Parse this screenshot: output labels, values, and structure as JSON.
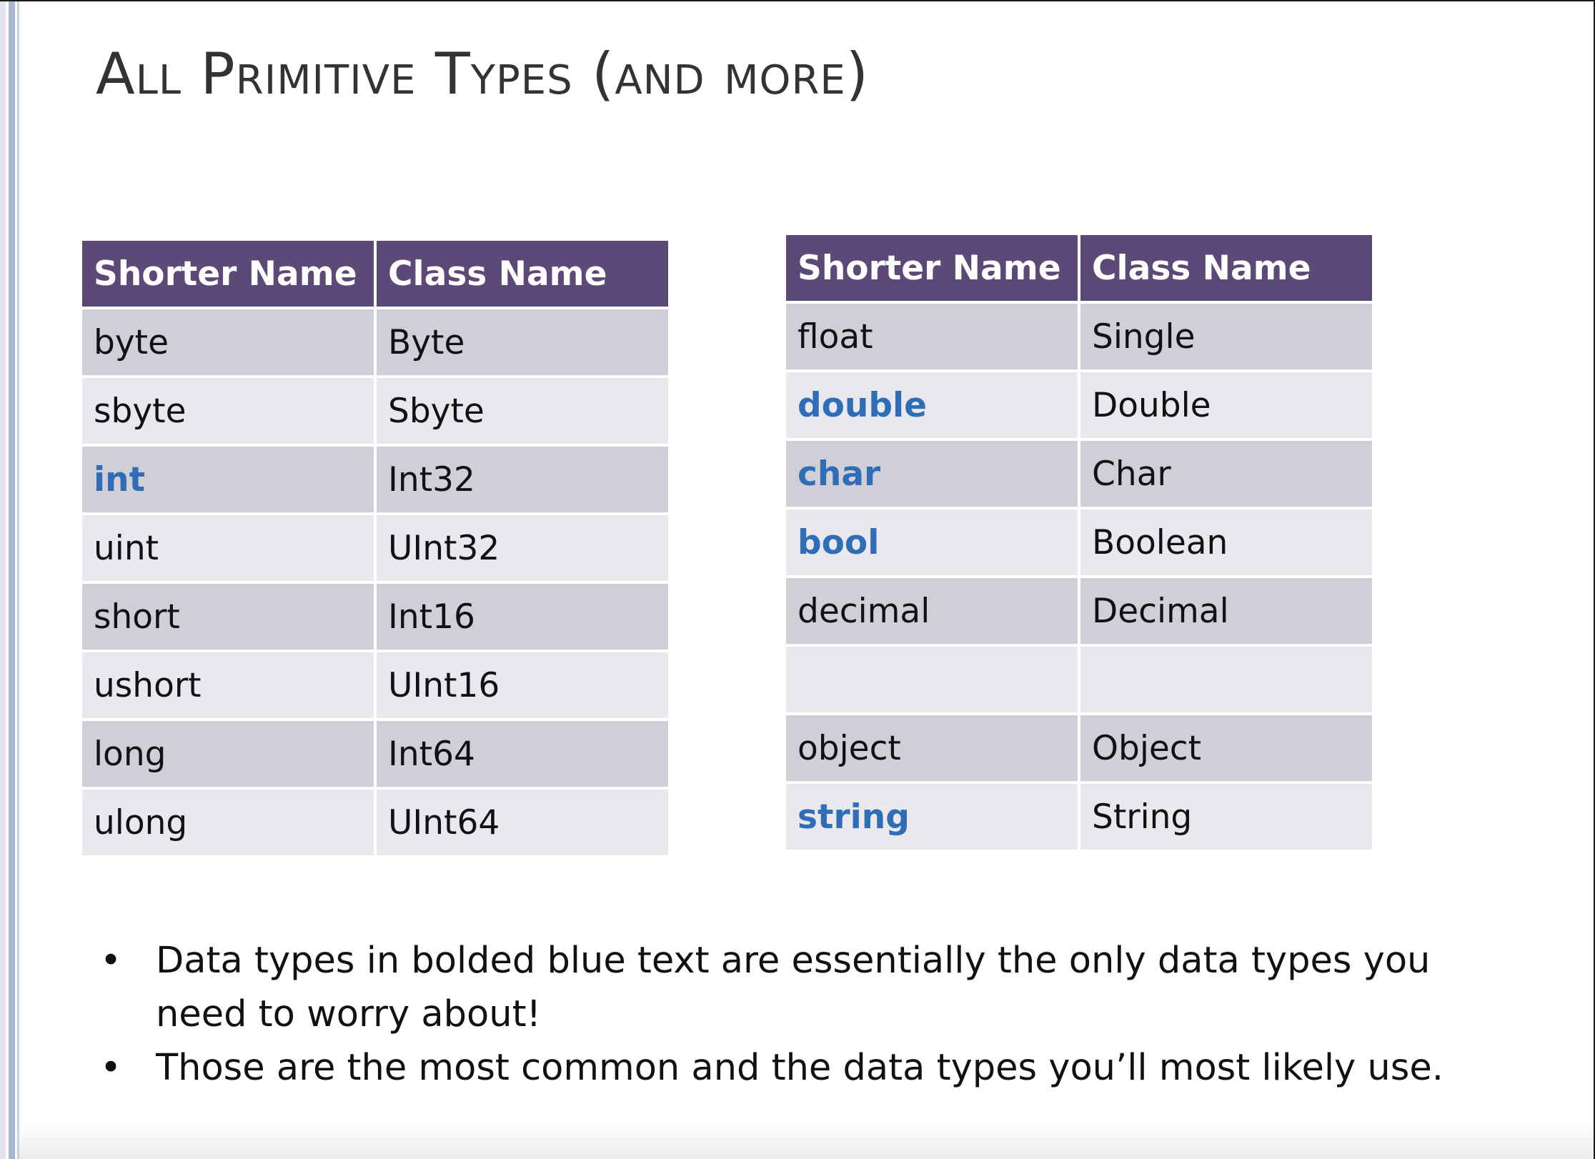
{
  "slide": {
    "title": "All Primitive Types (and more)"
  },
  "table_left": {
    "headers": [
      "Shorter Name",
      "Class Name"
    ],
    "rows": [
      {
        "short": "byte",
        "class": "Byte",
        "highlight": false
      },
      {
        "short": "sbyte",
        "class": "Sbyte",
        "highlight": false
      },
      {
        "short": "int",
        "class": "Int32",
        "highlight": true
      },
      {
        "short": "uint",
        "class": "UInt32",
        "highlight": false
      },
      {
        "short": "short",
        "class": "Int16",
        "highlight": false
      },
      {
        "short": "ushort",
        "class": "UInt16",
        "highlight": false
      },
      {
        "short": "long",
        "class": "Int64",
        "highlight": false
      },
      {
        "short": "ulong",
        "class": "UInt64",
        "highlight": false
      }
    ]
  },
  "table_right": {
    "headers": [
      "Shorter Name",
      "Class Name"
    ],
    "rows": [
      {
        "short": "float",
        "class": "Single",
        "highlight": false
      },
      {
        "short": "double",
        "class": "Double",
        "highlight": true
      },
      {
        "short": "char",
        "class": "Char",
        "highlight": true
      },
      {
        "short": "bool",
        "class": "Boolean",
        "highlight": true
      },
      {
        "short": "decimal",
        "class": "Decimal",
        "highlight": false
      },
      {
        "short": "",
        "class": "",
        "highlight": false
      },
      {
        "short": "object",
        "class": "Object",
        "highlight": false
      },
      {
        "short": "string",
        "class": "String",
        "highlight": true
      }
    ]
  },
  "notes": {
    "bullet": "•",
    "items": [
      "Data types in bolded blue text are essentially the only data types you need to worry about!",
      "Those are the most common and the data types you’ll most likely use."
    ]
  },
  "colors": {
    "header_bg": "#5d4977",
    "header_text": "#ffffff",
    "row_dark": "#d0ced7",
    "row_light": "#e9e8ed",
    "highlight_text": "#2f6db6",
    "title_text": "#333333"
  }
}
